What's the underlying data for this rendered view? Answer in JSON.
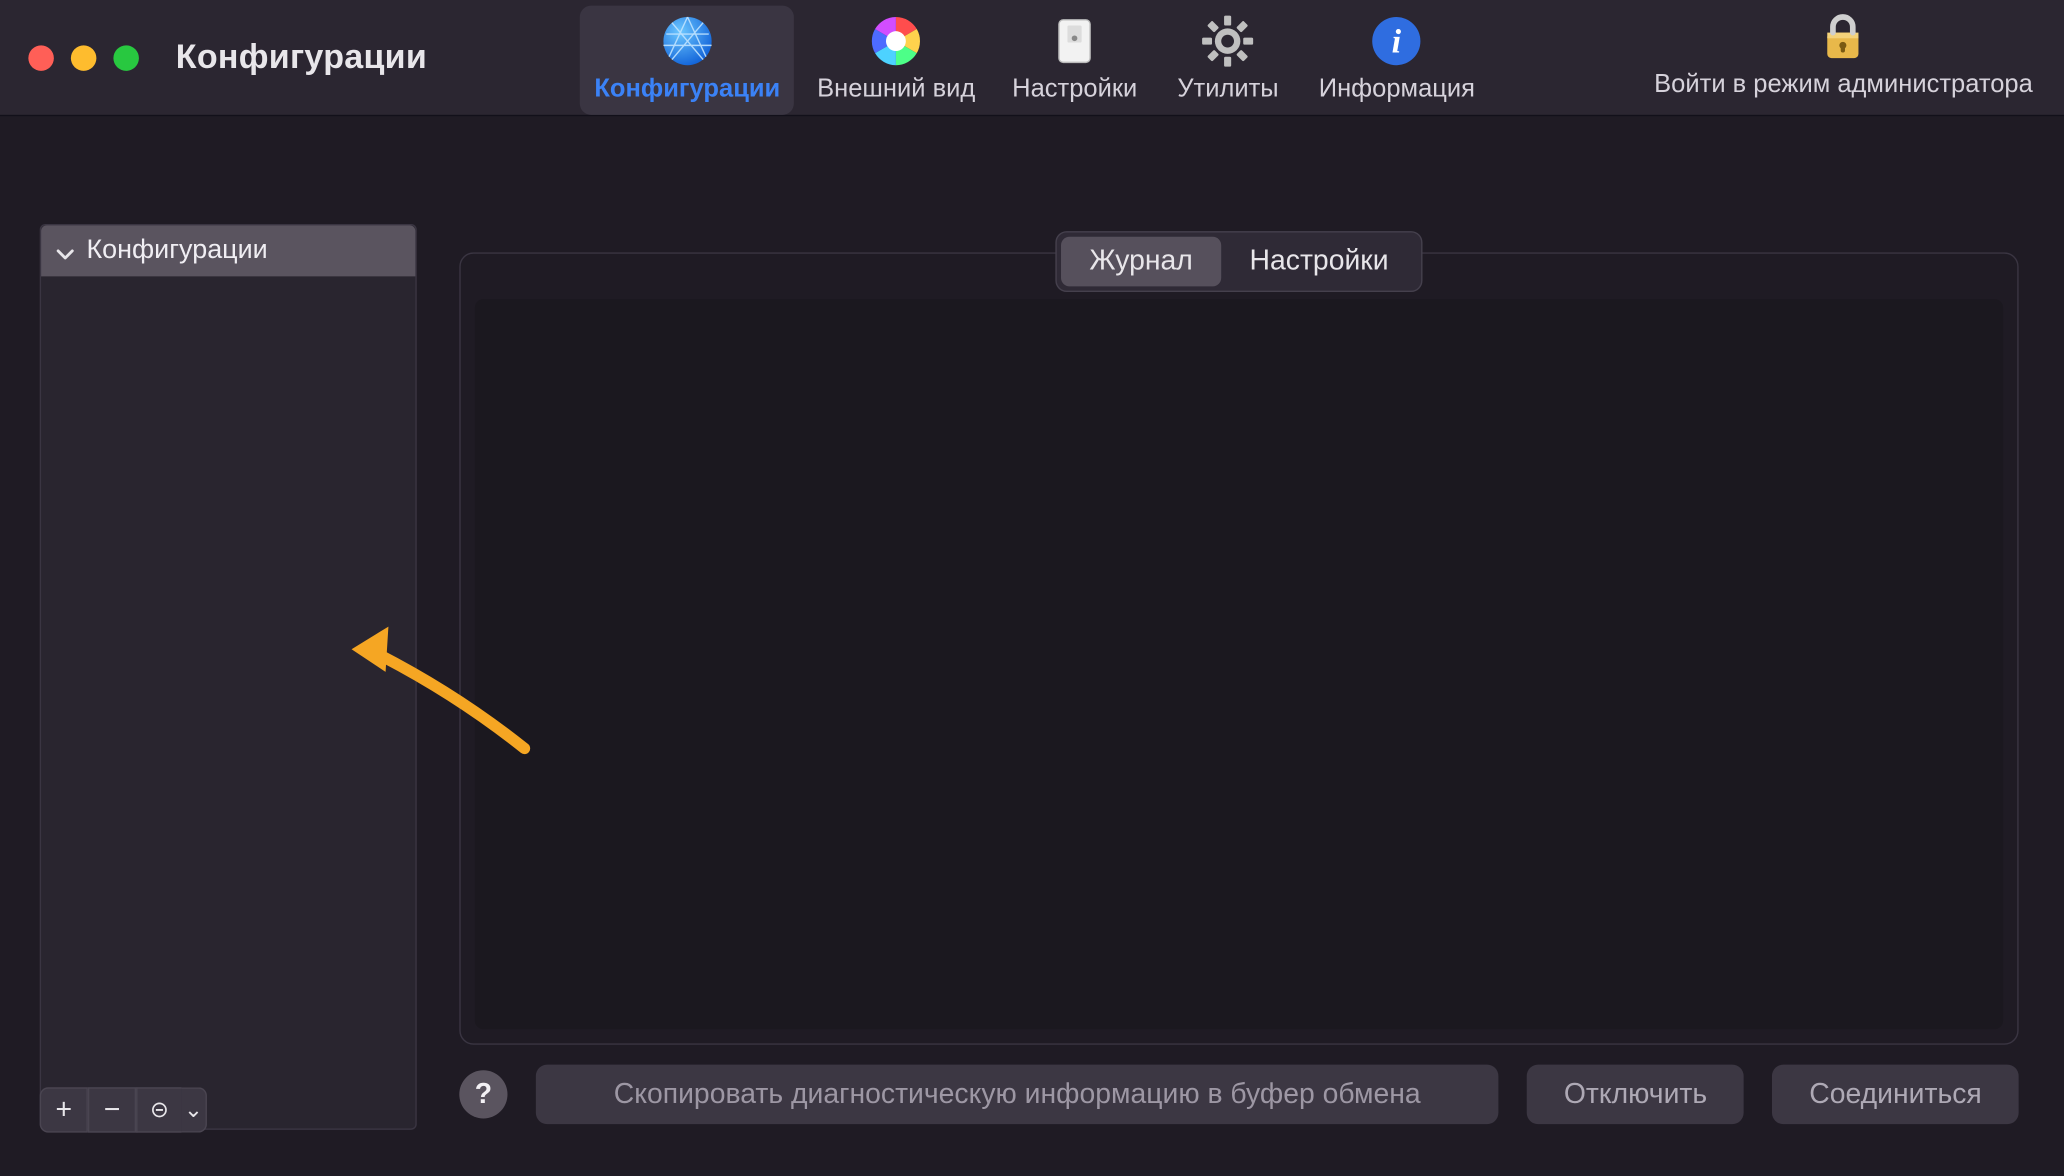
{
  "window": {
    "title": "Конфигурации"
  },
  "toolbar": {
    "items": [
      {
        "id": "configurations",
        "label": "Конфигурации",
        "active": true
      },
      {
        "id": "appearance",
        "label": "Внешний вид"
      },
      {
        "id": "settings",
        "label": "Настройки"
      },
      {
        "id": "utilities",
        "label": "Утилиты"
      },
      {
        "id": "information",
        "label": "Информация"
      }
    ],
    "admin_label": "Войти в режим администратора"
  },
  "sidebar": {
    "header": "Конфигурации",
    "footer": {
      "add_label": "+",
      "remove_label": "−",
      "more_symbol": "⊝",
      "dropdown_symbol": "⌄"
    }
  },
  "tabs": {
    "journal": "Журнал",
    "settings": "Настройки",
    "active": "journal"
  },
  "footer": {
    "help_symbol": "?",
    "copy_diag_label": "Скопировать диагностическую информацию в буфер обмена",
    "disconnect_label": "Отключить",
    "connect_label": "Соединиться"
  },
  "colors": {
    "accent": "#3b82f6",
    "annotation": "#f5a623"
  }
}
